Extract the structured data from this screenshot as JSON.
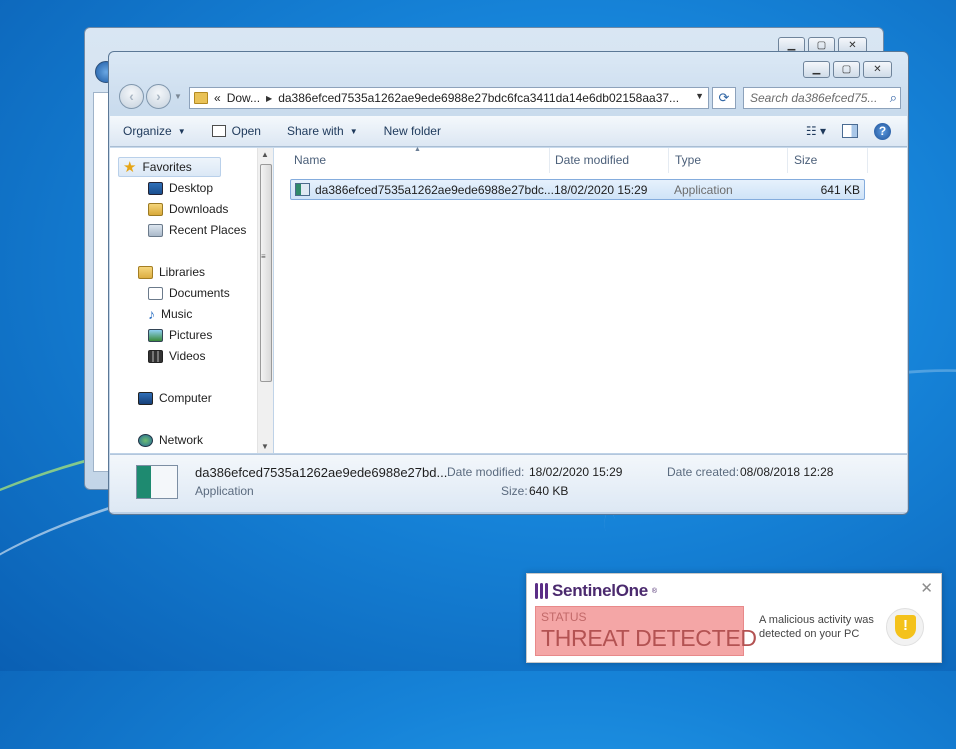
{
  "explorer": {
    "address": {
      "overflow": "«",
      "segment1": "Dow...",
      "segment2": "da386efced7535a1262ae9ede6988e27bdc6fca3411da14e6db02158aa37..."
    },
    "search_placeholder": "Search da386efced75...",
    "toolbar": {
      "organize": "Organize",
      "open": "Open",
      "share_with": "Share with",
      "new_folder": "New folder"
    },
    "nav": {
      "favorites": "Favorites",
      "desktop": "Desktop",
      "downloads": "Downloads",
      "recent_places": "Recent Places",
      "libraries": "Libraries",
      "documents": "Documents",
      "music": "Music",
      "pictures": "Pictures",
      "videos": "Videos",
      "computer": "Computer",
      "network": "Network"
    },
    "columns": {
      "name": "Name",
      "date_modified": "Date modified",
      "type": "Type",
      "size": "Size"
    },
    "files": [
      {
        "name": "da386efced7535a1262ae9ede6988e27bdc...",
        "date_modified": "18/02/2020 15:29",
        "type": "Application",
        "size": "641 KB"
      }
    ],
    "details": {
      "name": "da386efced7535a1262ae9ede6988e27bd...",
      "type": "Application",
      "date_modified_label": "Date modified:",
      "date_modified_value": "18/02/2020 15:29",
      "size_label": "Size:",
      "size_value": "640 KB",
      "date_created_label": "Date created:",
      "date_created_value": "08/08/2018 12:28"
    }
  },
  "toast": {
    "brand": "SentinelOne",
    "status_label": "STATUS",
    "status_value": "THREAT DETECTED",
    "message": "A malicious activity was detected on your PC"
  },
  "colors": {
    "threat_box": "#f4a6a6",
    "brand_purple": "#5b2e87",
    "shield_yellow": "#f4c21b"
  }
}
